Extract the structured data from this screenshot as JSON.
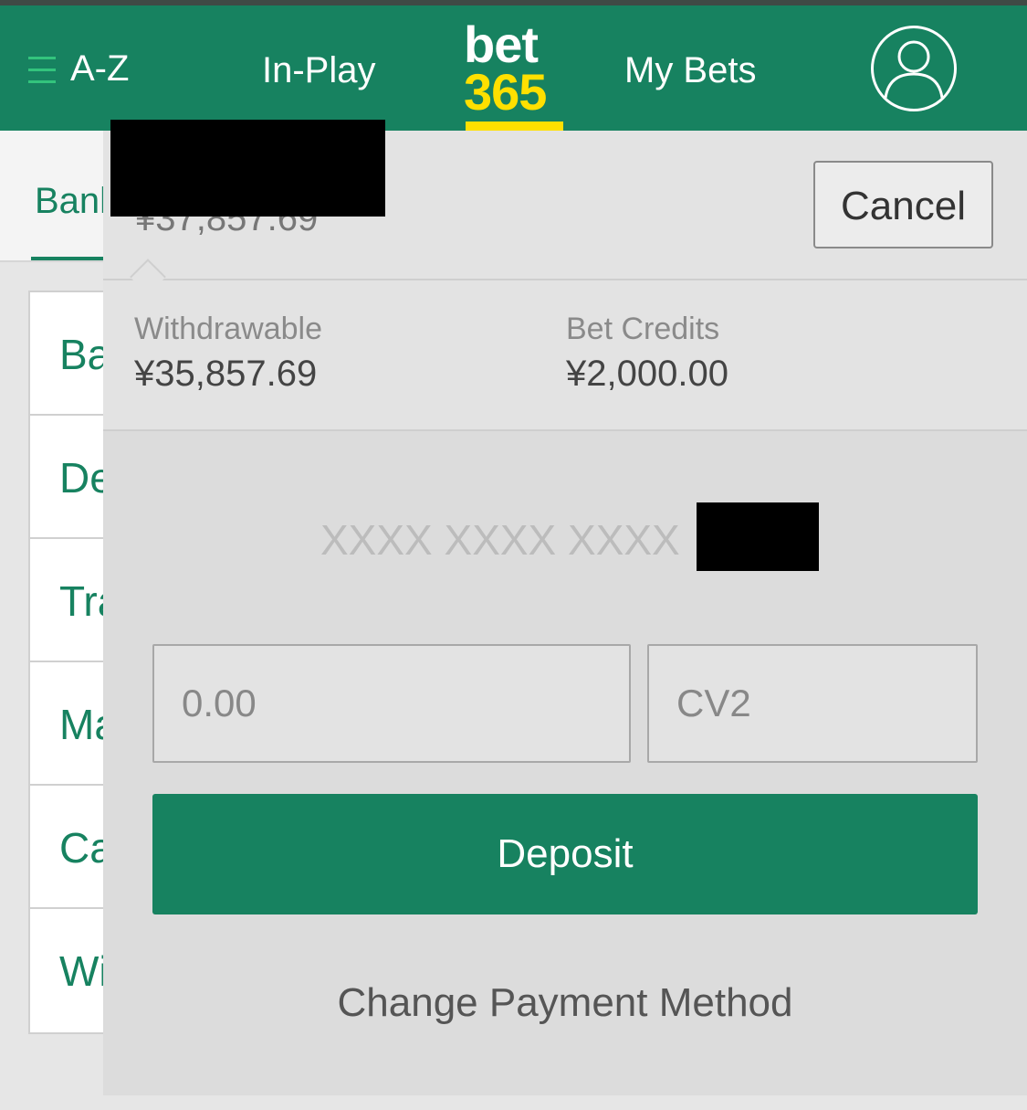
{
  "header": {
    "menu_label": "A-Z",
    "in_play_label": "In-Play",
    "logo_top": "bet",
    "logo_bottom": "365",
    "my_bets_label": "My Bets"
  },
  "background": {
    "tab_label": "Banl",
    "list_items": [
      "Ba",
      "De",
      "Tra",
      "Ma",
      "Ca",
      "Wi"
    ]
  },
  "panel": {
    "total_balance": "¥37,857.69",
    "cancel_label": "Cancel",
    "withdrawable_label": "Withdrawable",
    "withdrawable_value": "¥35,857.69",
    "bet_credits_label": "Bet Credits",
    "bet_credits_value": "¥2,000.00",
    "card_number_masked": "XXXX XXXX XXXX",
    "amount_placeholder": "0.00",
    "cv2_placeholder": "CV2",
    "deposit_label": "Deposit",
    "change_payment_label": "Change Payment Method"
  },
  "colors": {
    "brand_green": "#178260",
    "logo_yellow": "#ffe000",
    "hamburger_green": "#33c47d"
  }
}
